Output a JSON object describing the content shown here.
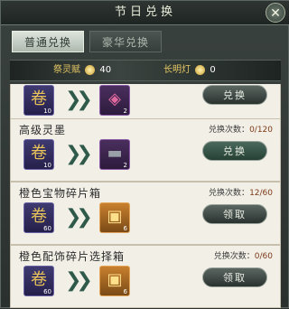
{
  "window": {
    "title": "节日兑换",
    "close": "✕"
  },
  "tabs": [
    {
      "label": "普通兑换",
      "active": true
    },
    {
      "label": "豪华兑换",
      "active": false
    }
  ],
  "currency": {
    "item1_label": "祭灵赋",
    "item1_value": "40",
    "item2_label": "长明灯",
    "item2_value": "0"
  },
  "items": [
    {
      "title": "",
      "count_label": "",
      "count_value": "",
      "cost_qty": "10",
      "target_qty": "2",
      "action": "兑换",
      "target_icon": "gem-box-icon"
    },
    {
      "title": "高级灵墨",
      "count_label": "兑换次数：",
      "count_value": "0/120",
      "cost_qty": "10",
      "target_qty": "2",
      "action": "兑换",
      "target_icon": "ink-stick-icon"
    },
    {
      "title": "橙色宝物碎片箱",
      "count_label": "兑换次数：",
      "count_value": "12/60",
      "cost_qty": "60",
      "target_qty": "6",
      "action": "领取",
      "target_icon": "treasure-chest-icon"
    },
    {
      "title": "橙色配饰碎片选择箱",
      "count_label": "兑换次数：",
      "count_value": "0/60",
      "cost_qty": "60",
      "target_qty": "6",
      "action": "领取",
      "target_icon": "accessory-chest-icon"
    }
  ],
  "colors": {
    "accent": "#2f5a4a",
    "gold": "#e6c864"
  }
}
